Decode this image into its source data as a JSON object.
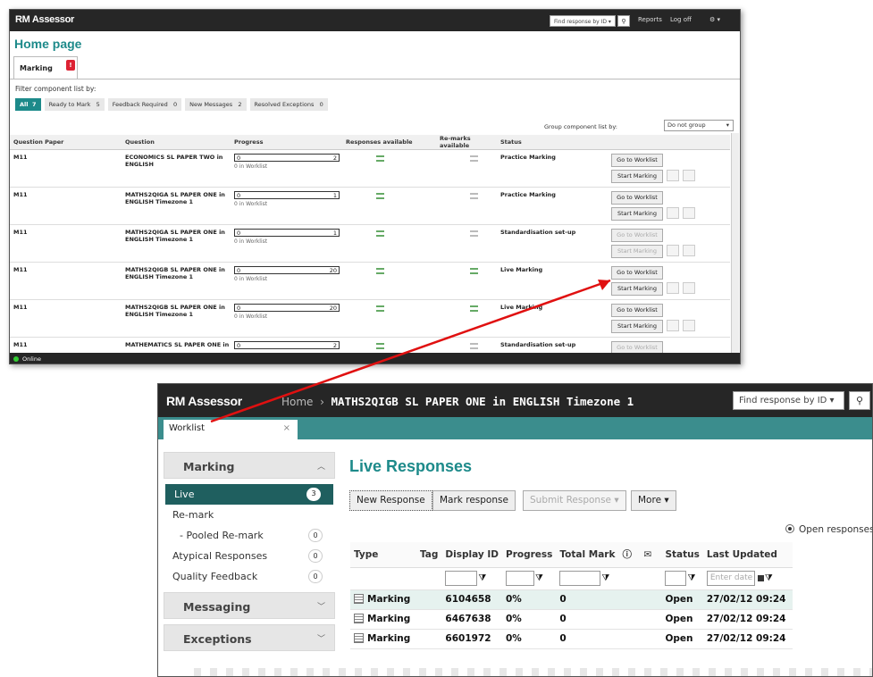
{
  "top": {
    "app_logo": "RM Assessor",
    "find": "Find response by ID ▾",
    "find_btn": "⚲",
    "reports": "Reports",
    "logoff": "Log off",
    "gear": "⚙ ▾",
    "page_title": "Home page",
    "tab_label": "Marking",
    "filter_label": "Filter component list by:",
    "filters": [
      {
        "label": "All",
        "count": "7"
      },
      {
        "label": "Ready to Mark",
        "count": "5"
      },
      {
        "label": "Feedback Required",
        "count": "0"
      },
      {
        "label": "New Messages",
        "count": "2"
      },
      {
        "label": "Resolved Exceptions",
        "count": "0"
      }
    ],
    "group_label": "Group component list by:",
    "group_value": "Do not group",
    "columns": [
      "Question Paper",
      "Question",
      "Progress",
      "Responses available",
      "Re-marks available",
      "Status"
    ],
    "rows": [
      {
        "paper": "M11",
        "question": "ECONOMICS SL PAPER TWO in ENGLISH",
        "progress": "0",
        "max": "2",
        "worklist": "0 in Worklist",
        "status": "Practice Marking",
        "go": "Go to Worklist",
        "start": "Start Marking",
        "enabled": true
      },
      {
        "paper": "M11",
        "question": "MATHS2QIGA SL PAPER ONE in ENGLISH Timezone 1",
        "progress": "0",
        "max": "1",
        "worklist": "0 in Worklist",
        "status": "Practice Marking",
        "go": "Go to Worklist",
        "start": "Start Marking",
        "enabled": true
      },
      {
        "paper": "M11",
        "question": "MATHS2QIGA SL PAPER ONE in ENGLISH Timezone 1",
        "progress": "0",
        "max": "1",
        "worklist": "0 in Worklist",
        "status": "Standardisation set-up",
        "go": "Go to Worklist",
        "start": "Start Marking",
        "enabled": false
      },
      {
        "paper": "M11",
        "question": "MATHS2QIGB SL PAPER ONE in ENGLISH Timezone 1",
        "progress": "0",
        "max": "20",
        "worklist": "0 in Worklist",
        "status": "Live Marking",
        "go": "Go to Worklist",
        "start": "Start Marking",
        "enabled": true
      },
      {
        "paper": "M11",
        "question": "MATHS2QIGB SL PAPER ONE in ENGLISH Timezone 1",
        "progress": "0",
        "max": "20",
        "worklist": "0 in Worklist",
        "status": "Live Marking",
        "go": "Go to Worklist",
        "start": "Start Marking",
        "enabled": true
      },
      {
        "paper": "M11",
        "question": "MATHEMATICS SL PAPER ONE in",
        "progress": "0",
        "max": "2",
        "worklist": "",
        "status": "Standardisation set-up",
        "go": "Go to Worklist",
        "start": "",
        "enabled": false
      }
    ],
    "footer": "Online"
  },
  "bottom": {
    "app_logo": "RM Assessor",
    "crumb_home": "Home",
    "crumb_sep": "›",
    "crumb_current": "MATHS2QIGB SL PAPER ONE in ENGLISH Timezone 1",
    "find": "Find response by ID ▾",
    "find_btn": "⚲",
    "tab_label": "Worklist",
    "tab_close": "×",
    "marking_header": "Marking",
    "items": [
      {
        "label": "Live",
        "count": "3"
      },
      {
        "label": "Re-mark",
        "count": ""
      },
      {
        "label": "- Pooled Re-mark",
        "count": "0"
      },
      {
        "label": "Atypical Responses",
        "count": "0"
      },
      {
        "label": "Quality Feedback",
        "count": "0"
      }
    ],
    "messaging_header": "Messaging",
    "exceptions_header": "Exceptions",
    "page_title": "Live Responses",
    "buttons": {
      "new": "New Response",
      "mark": "Mark response",
      "submit": "Submit Response ▾",
      "more": "More ▾"
    },
    "radio_label": "Open responses",
    "columns": [
      "Type",
      "Tag",
      "Display ID",
      "Progress",
      "Total Mark",
      "ⓘ",
      "✉",
      "Status",
      "Last Updated"
    ],
    "date_placeholder": "Enter date",
    "rows": [
      {
        "type": "Marking",
        "id": "6104658",
        "progress": "0%",
        "total": "0",
        "status": "Open",
        "updated": "27/02/12 09:24"
      },
      {
        "type": "Marking",
        "id": "6467638",
        "progress": "0%",
        "total": "0",
        "status": "Open",
        "updated": "27/02/12 09:24"
      },
      {
        "type": "Marking",
        "id": "6601972",
        "progress": "0%",
        "total": "0",
        "status": "Open",
        "updated": "27/02/12 09:24"
      }
    ]
  },
  "colors": {
    "accent": "#1d8a8a",
    "topbar": "#262626",
    "arrow": "#e01010",
    "selected": "#1f5f5f"
  }
}
